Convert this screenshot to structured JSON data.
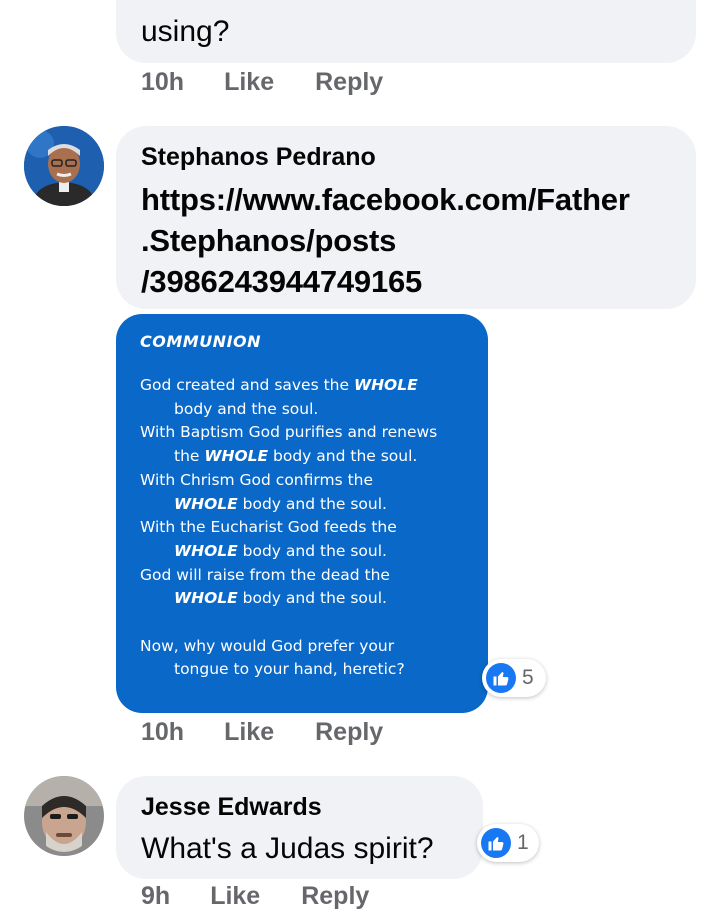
{
  "top_comment": {
    "text_tail": "using?",
    "time": "10h",
    "like_label": "Like",
    "reply_label": "Reply"
  },
  "comment_1": {
    "author": "Stephanos Pedrano",
    "link_lines": [
      "https://www.facebook.com/Father",
      ".Stephanos/posts",
      "/3986243944749165"
    ],
    "image": {
      "title": "COMMUNION",
      "lines": [
        {
          "pre": "God created and saves the ",
          "bold": "WHOLE",
          "post": ""
        },
        {
          "pre": "body and the soul.",
          "bold": "",
          "post": ""
        },
        {
          "pre": "With Baptism God purifies and renews",
          "bold": "",
          "post": ""
        },
        {
          "pre": "the ",
          "bold": "WHOLE",
          "post": " body and the soul."
        },
        {
          "pre": "With Chrism God confirms the",
          "bold": "",
          "post": ""
        },
        {
          "pre": "",
          "bold": "WHOLE",
          "post": " body and the soul."
        },
        {
          "pre": "With the Eucharist God feeds the",
          "bold": "",
          "post": ""
        },
        {
          "pre": "",
          "bold": "WHOLE",
          "post": " body and the soul."
        },
        {
          "pre": "God will raise from the dead the",
          "bold": "",
          "post": ""
        },
        {
          "pre": "",
          "bold": "WHOLE",
          "post": " body and the soul."
        },
        {
          "pre": "Now, why would God prefer your",
          "bold": "",
          "post": ""
        },
        {
          "pre": "tongue to your hand, heretic?",
          "bold": "",
          "post": ""
        }
      ]
    },
    "reaction_count": "5",
    "time": "10h",
    "like_label": "Like",
    "reply_label": "Reply"
  },
  "comment_2": {
    "author": "Jesse Edwards",
    "text": "What's a Judas spirit?",
    "reaction_count": "1",
    "time": "9h",
    "like_label": "Like",
    "reply_label": "Reply"
  },
  "colors": {
    "bubble": "#f0f2f5",
    "meta_text": "#65676b",
    "like_blue": "#1877f2",
    "image_blue": "#0a68c8"
  }
}
